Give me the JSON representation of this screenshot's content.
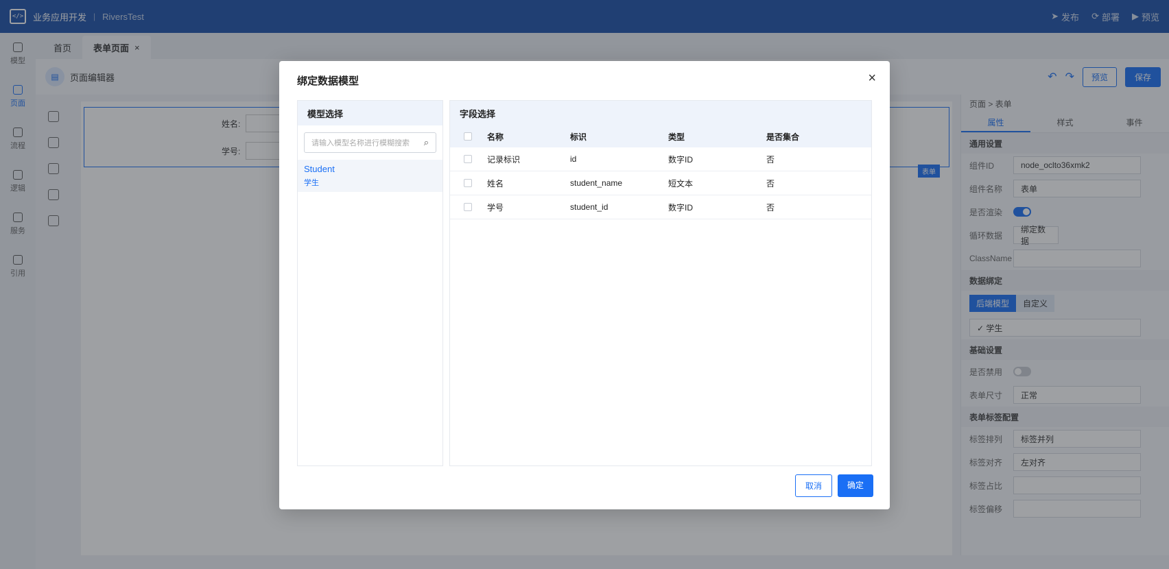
{
  "topbar": {
    "app_name": "业务应用开发",
    "divider": "|",
    "project": "RiversTest",
    "actions": [
      "发布",
      "部署",
      "预览"
    ]
  },
  "rail": [
    {
      "label": "模型",
      "icon": "model-icon"
    },
    {
      "label": "页面",
      "icon": "page-icon",
      "active": true
    },
    {
      "label": "流程",
      "icon": "flow-icon"
    },
    {
      "label": "逻辑",
      "icon": "logic-icon"
    },
    {
      "label": "服务",
      "icon": "service-icon"
    },
    {
      "label": "引用",
      "icon": "reference-icon"
    }
  ],
  "tabs": [
    {
      "label": "首页"
    },
    {
      "label": "表单页面",
      "close": "×"
    }
  ],
  "editor": {
    "title": "页面编辑器",
    "preview": "预览",
    "save": "保存"
  },
  "canvas": {
    "fields": [
      "姓名:",
      "学号:"
    ],
    "component_tag": "表单"
  },
  "props": {
    "crumb": "页面 > 表单",
    "tabs": [
      "属性",
      "样式",
      "事件"
    ],
    "general": {
      "title": "通用设置",
      "component_id_label": "组件ID",
      "component_id": "node_oclto36xmk2",
      "component_name_label": "组件名称",
      "component_name": "表单",
      "render_label": "是否渲染",
      "loop_label": "循环数据",
      "loop_btn": "绑定数据",
      "classname_label": "ClassName"
    },
    "binding": {
      "title": "数据绑定",
      "seg_backend": "后端模型",
      "seg_custom": "自定义",
      "selected": "✓ 学生"
    },
    "basic": {
      "title": "基础设置",
      "disabled_label": "是否禁用",
      "size_label": "表单尺寸",
      "size": "正常"
    },
    "label_cfg": {
      "title": "表单标签配置",
      "arrange_label": "标签排列",
      "arrange": "标签并列",
      "align_label": "标签对齐",
      "align": "左对齐",
      "ratio_label": "标签占比",
      "offset_label": "标签偏移"
    }
  },
  "modal": {
    "title": "绑定数据模型",
    "close": "×",
    "model_panel_title": "模型选择",
    "search_placeholder": "请输入模型名称进行模糊搜索",
    "models": [
      {
        "en": "Student",
        "cn": "学生"
      }
    ],
    "field_panel_title": "字段选择",
    "columns": [
      "名称",
      "标识",
      "类型",
      "是否集合"
    ],
    "rows": [
      {
        "name": "记录标识",
        "key": "id",
        "type": "数字ID",
        "collection": "否"
      },
      {
        "name": "姓名",
        "key": "student_name",
        "type": "短文本",
        "collection": "否"
      },
      {
        "name": "学号",
        "key": "student_id",
        "type": "数字ID",
        "collection": "否"
      }
    ],
    "cancel": "取消",
    "ok": "确定"
  }
}
